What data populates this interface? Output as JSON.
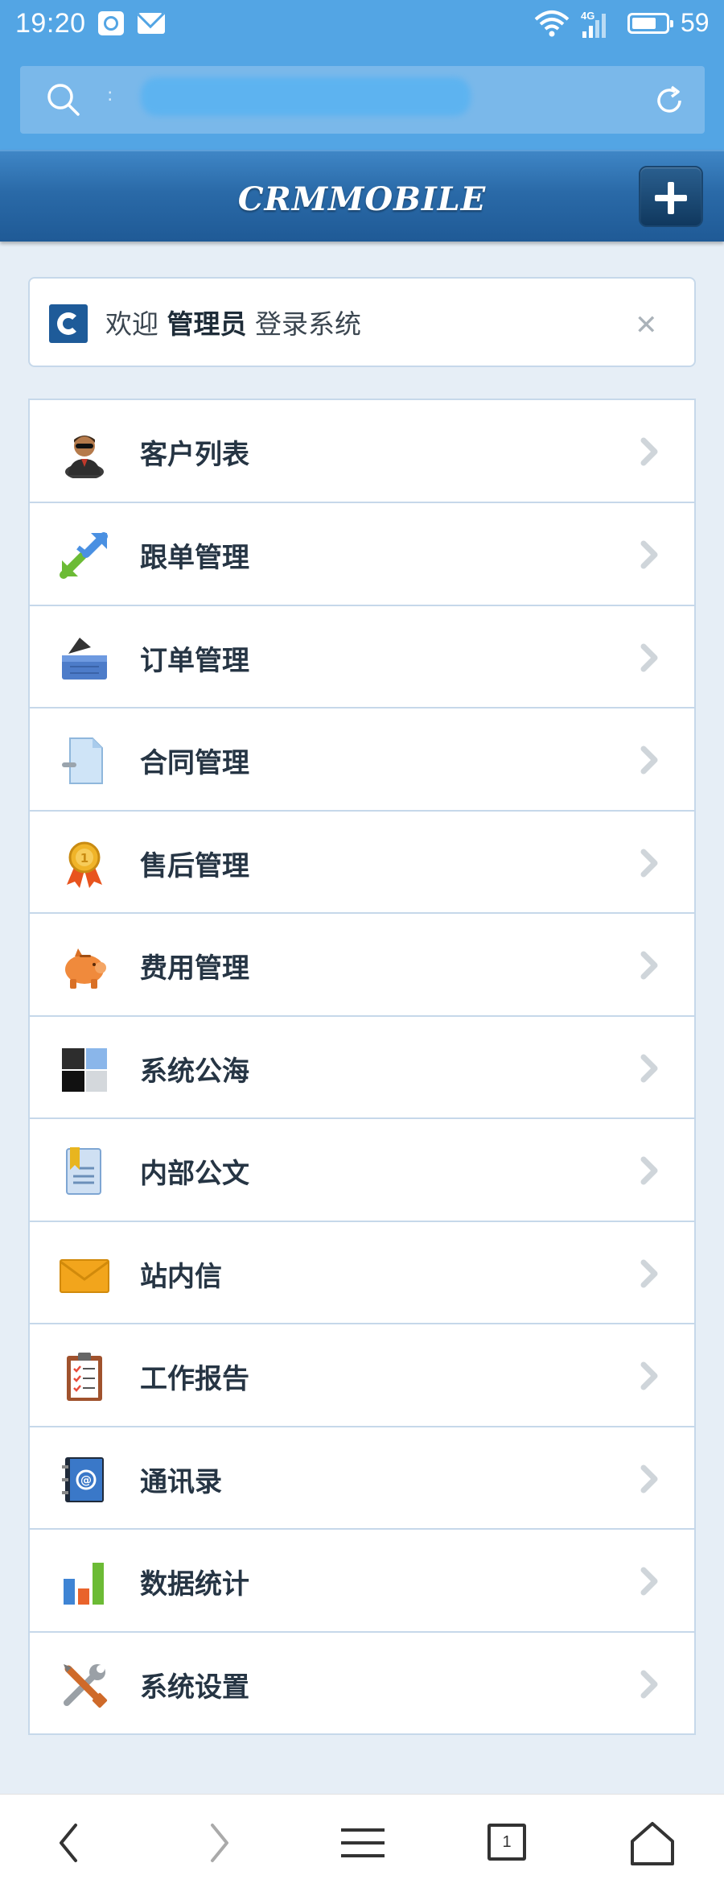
{
  "status_bar": {
    "time": "19:20",
    "network": "4G",
    "battery_level": "59",
    "icons": [
      "app-notification-icon",
      "mail-icon",
      "wifi-icon",
      "signal-icon",
      "battery-icon"
    ]
  },
  "browser": {
    "url_text": ":",
    "url_obscured": true,
    "icons": [
      "search-icon",
      "refresh-icon"
    ]
  },
  "app_header": {
    "logo": "CRMMOBILE",
    "add_button_icon": "plus-icon"
  },
  "welcome": {
    "prefix": "欢迎",
    "username": "管理员",
    "suffix": "登录系统",
    "close_icon": "close-icon"
  },
  "menu": {
    "items": [
      {
        "label": "客户列表",
        "icon": "customer-icon"
      },
      {
        "label": "跟单管理",
        "icon": "follow-up-arrows-icon"
      },
      {
        "label": "订单管理",
        "icon": "order-basket-icon"
      },
      {
        "label": "合同管理",
        "icon": "contract-document-icon"
      },
      {
        "label": "售后管理",
        "icon": "award-medal-icon"
      },
      {
        "label": "费用管理",
        "icon": "piggy-bank-icon"
      },
      {
        "label": "系统公海",
        "icon": "squares-grid-icon"
      },
      {
        "label": "内部公文",
        "icon": "bookmark-document-icon"
      },
      {
        "label": "站内信",
        "icon": "envelope-icon"
      },
      {
        "label": "工作报告",
        "icon": "clipboard-checklist-icon"
      },
      {
        "label": "通讯录",
        "icon": "address-book-icon"
      },
      {
        "label": "数据统计",
        "icon": "bar-chart-icon"
      },
      {
        "label": "系统设置",
        "icon": "tools-wrench-icon"
      }
    ]
  },
  "bottom_nav": {
    "tab_count": "1",
    "icons": [
      "back-icon",
      "forward-icon",
      "menu-icon",
      "tabs-icon",
      "home-icon"
    ]
  },
  "colors": {
    "status_bar": "#53a5e4",
    "header": "#2a6aa8",
    "page_bg": "#e6eef6",
    "label": "#263544"
  }
}
